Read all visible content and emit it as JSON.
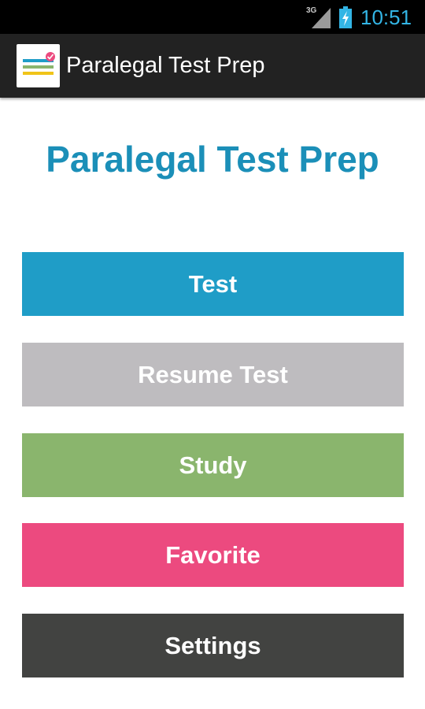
{
  "status_bar": {
    "network": "3G",
    "time": "10:51",
    "icons": [
      "signal-icon",
      "battery-charging-icon"
    ]
  },
  "action_bar": {
    "app_icon": "app-logo-icon",
    "title": "Paralegal Test Prep"
  },
  "main": {
    "heading": "Paralegal Test Prep",
    "buttons": [
      {
        "label": "Test",
        "color": "#1f9dc7"
      },
      {
        "label": "Resume Test",
        "color": "#bebcbf"
      },
      {
        "label": "Study",
        "color": "#8ab56d"
      },
      {
        "label": "Favorite",
        "color": "#ec4a7f"
      },
      {
        "label": "Settings",
        "color": "#424341"
      }
    ]
  },
  "colors": {
    "status_bar_bg": "#000000",
    "action_bar_bg": "#222222",
    "clock": "#33b5e5",
    "heading": "#1b8fb8"
  }
}
